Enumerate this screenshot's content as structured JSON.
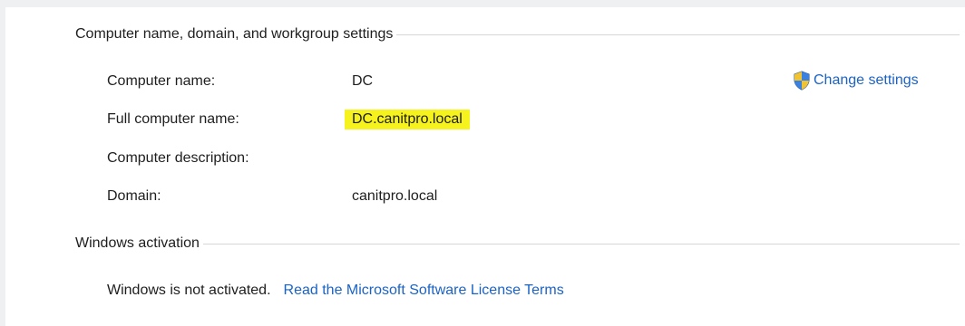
{
  "computer_section": {
    "heading": "Computer name, domain, and workgroup settings",
    "rows": [
      {
        "label": "Computer name:",
        "value": "DC"
      },
      {
        "label": "Full computer name:",
        "value": "DC.canitpro.local"
      },
      {
        "label": "Computer description:",
        "value": ""
      },
      {
        "label": "Domain:",
        "value": "canitpro.local"
      }
    ],
    "change_settings_label": "Change settings",
    "change_settings_icon": "uac-shield-icon",
    "highlight_color": "#f6f21e"
  },
  "activation_section": {
    "heading": "Windows activation",
    "status": "Windows is not activated.",
    "license_link": "Read the Microsoft Software License Terms"
  },
  "colors": {
    "link": "#1a63c5",
    "background": "#eff0f1",
    "panel": "#ffffff"
  }
}
